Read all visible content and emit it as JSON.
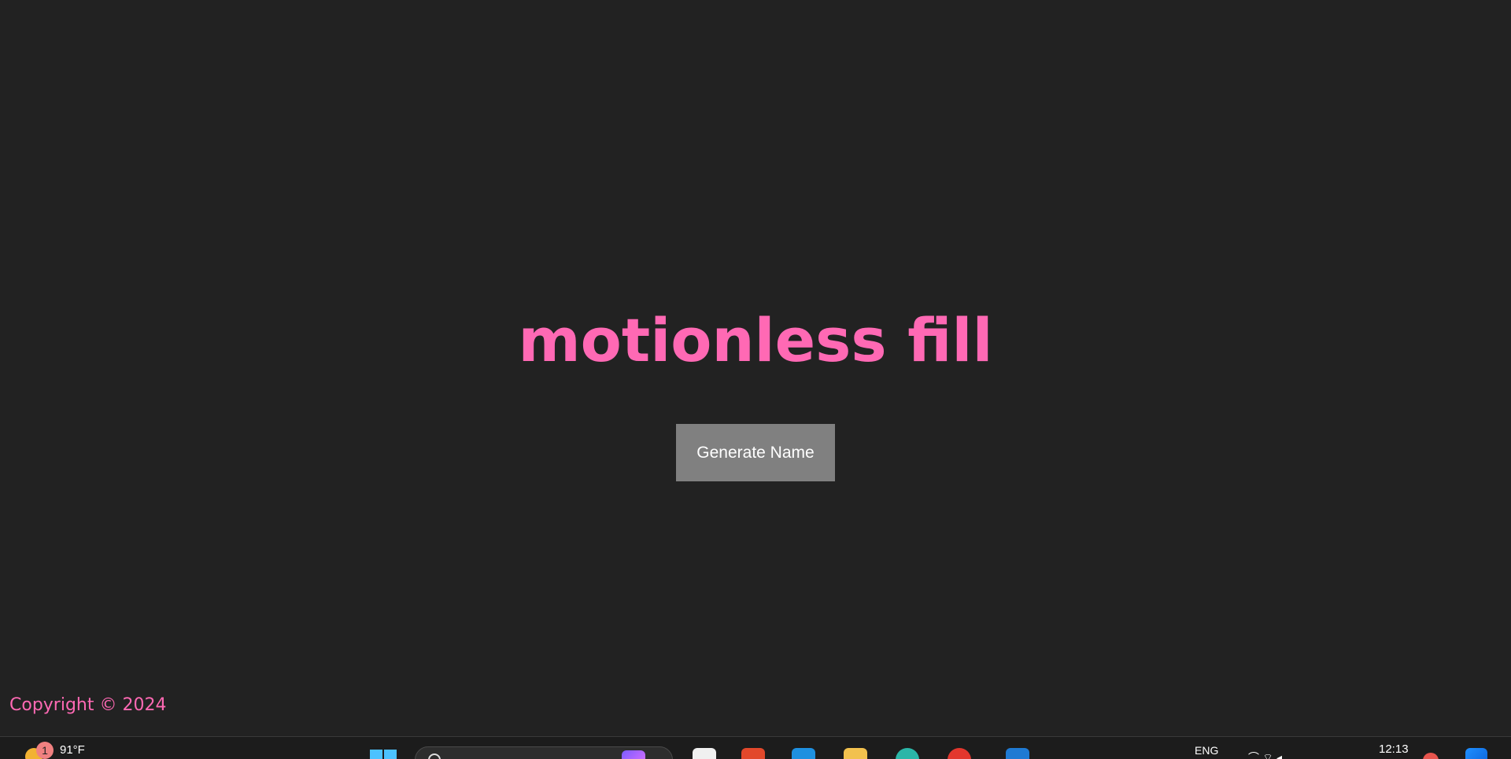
{
  "main": {
    "title": "motionless fill",
    "generate_button_label": "Generate Name",
    "copyright": "Copyright © 2024"
  },
  "taskbar": {
    "weather_badge_count": "1",
    "temperature": "91°F",
    "language": "ENG",
    "time": "12:13",
    "apps": [
      {
        "name": "notepad-icon",
        "color": "#f0f0f0"
      },
      {
        "name": "office-icon",
        "color": "#e2482b"
      },
      {
        "name": "store-icon",
        "color": "#1e90e0"
      },
      {
        "name": "file-explorer-icon",
        "color": "#f2c14e"
      },
      {
        "name": "edge-icon",
        "color": "#2bb6a8"
      },
      {
        "name": "browser-icon",
        "color": "#e3372e"
      },
      {
        "name": "vscode-icon",
        "color": "#1f7ad3"
      }
    ]
  },
  "colors": {
    "background": "#222222",
    "accent_pink": "#ff69b4",
    "button_bg": "#808080",
    "button_text": "#ffffff"
  }
}
